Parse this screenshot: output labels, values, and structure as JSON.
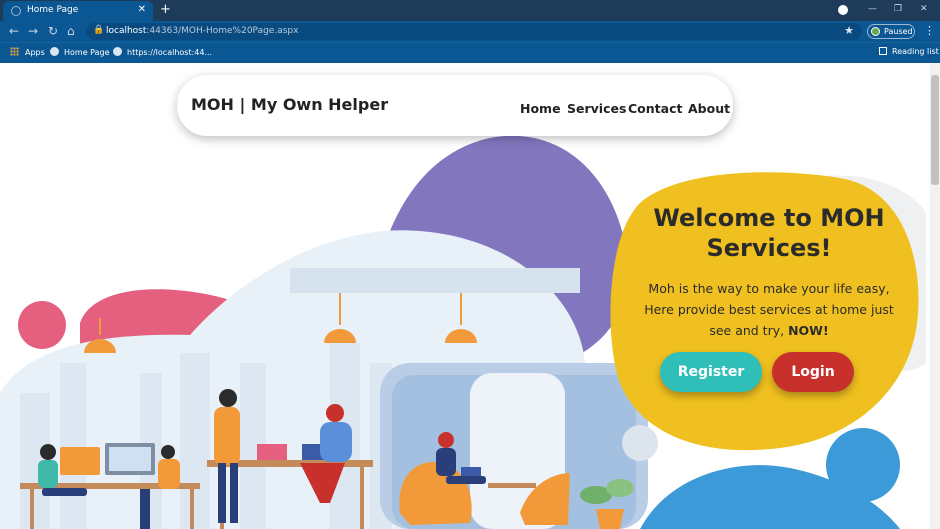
{
  "browser": {
    "tab_title": "Home Page",
    "tab_close": "✕",
    "new_tab": "+",
    "url_host": "localhost",
    "url_rest": ":44363/MOH-Home%20Page.aspx",
    "profile_status": "Paused",
    "bookmarks": [
      "Apps",
      "Home Page",
      "https://localhost:44..."
    ],
    "reading_list": "Reading list",
    "icons": [
      "back-icon",
      "forward-icon",
      "reload-icon",
      "home-icon",
      "lock-icon",
      "star-icon",
      "menu-icon"
    ]
  },
  "site": {
    "brand": "MOH | My Own Helper",
    "nav": [
      "Home",
      "Services",
      "Contact",
      "About"
    ]
  },
  "hero": {
    "title": "Welcome to MOH Services!",
    "desc_lines": [
      "Moh is the way to make your life easy,",
      "Here provide best services at home just",
      "see and try,"
    ],
    "desc_emphasis": "NOW!",
    "register": "Register",
    "login": "Login"
  },
  "colors": {
    "card": "#f0c020",
    "purple": "#8277bf",
    "pink": "#e5607f",
    "blue": "#3d9ad9",
    "register": "#2fbfb8",
    "login": "#c8302c",
    "chrome": "#0b5794"
  }
}
